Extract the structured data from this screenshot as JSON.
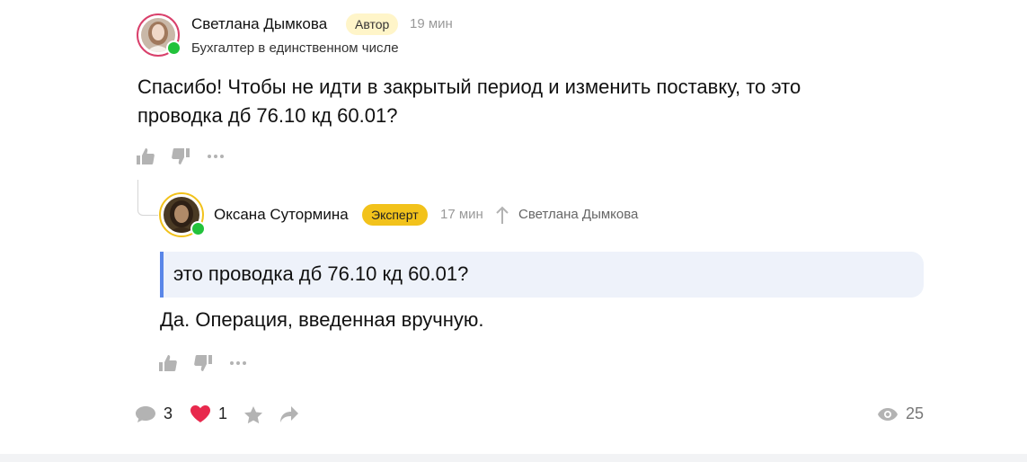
{
  "comment1": {
    "author": "Светлана Дымкова",
    "badge": "Автор",
    "time": "19 мин",
    "subtitle": "Бухгалтер в единственном числе",
    "text": "Спасибо! Чтобы не идти в закрытый период и изменить поставку, то это проводка дб 76.10 кд 60.01?",
    "icons": [
      "thumbs-up-icon",
      "thumbs-down-icon",
      "more-icon"
    ]
  },
  "comment2": {
    "author": "Оксана Сутормина",
    "badge": "Эксперт",
    "time": "17 мин",
    "reply_to": "Светлана Дымкова",
    "quote": "это проводка дб 76.10 кд 60.01?",
    "text": "Да. Операция, введенная вручную.",
    "icons": [
      "thumbs-up-icon",
      "thumbs-down-icon",
      "more-icon"
    ]
  },
  "footer": {
    "comments_count": "3",
    "likes_count": "1",
    "views_count": "25",
    "icons": [
      "comment-icon",
      "heart-icon",
      "star-icon",
      "share-icon",
      "eye-icon"
    ]
  },
  "colors": {
    "author_badge_bg": "#fff5c9",
    "expert_badge_bg": "#f2c21b",
    "online": "#22c23b",
    "heart": "#e8294d",
    "quote_bar": "#5a86e8",
    "quote_bg": "#eef2fa"
  }
}
